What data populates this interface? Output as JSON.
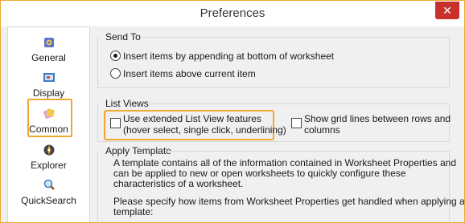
{
  "window": {
    "title": "Preferences",
    "close_glyph": "✕"
  },
  "sidebar": {
    "items": [
      {
        "label": "General",
        "icon": "general-icon"
      },
      {
        "label": "Display",
        "icon": "display-icon"
      },
      {
        "label": "Common",
        "icon": "common-icon",
        "selected": true
      },
      {
        "label": "Explorer",
        "icon": "explorer-icon"
      },
      {
        "label": "QuickSearch",
        "icon": "quicksearch-icon"
      }
    ]
  },
  "send_to": {
    "title": "Send To",
    "options": [
      {
        "label": "Insert items by appending at bottom of worksheet",
        "selected": true
      },
      {
        "label": "Insert items above current item",
        "selected": false
      }
    ]
  },
  "list_views": {
    "title": "List Views",
    "extended": {
      "line1": "Use extended List View features",
      "line2": "(hover select, single click, underlining)",
      "checked": false
    },
    "grid": {
      "line1": "Show grid lines between rows and",
      "line2": "columns",
      "checked": false
    }
  },
  "apply_template": {
    "title": "Apply Template",
    "para1": [
      "A template contains all of the information contained in Worksheet Properties and",
      "can be applied to new or open worksheets to quickly configure these",
      "characteristics of a worksheet."
    ],
    "para2": [
      "Please specify how items from Worksheet Properties get handled when applying a",
      "template:"
    ]
  },
  "colors": {
    "highlight": "#f0a830",
    "close": "#c7302b"
  }
}
